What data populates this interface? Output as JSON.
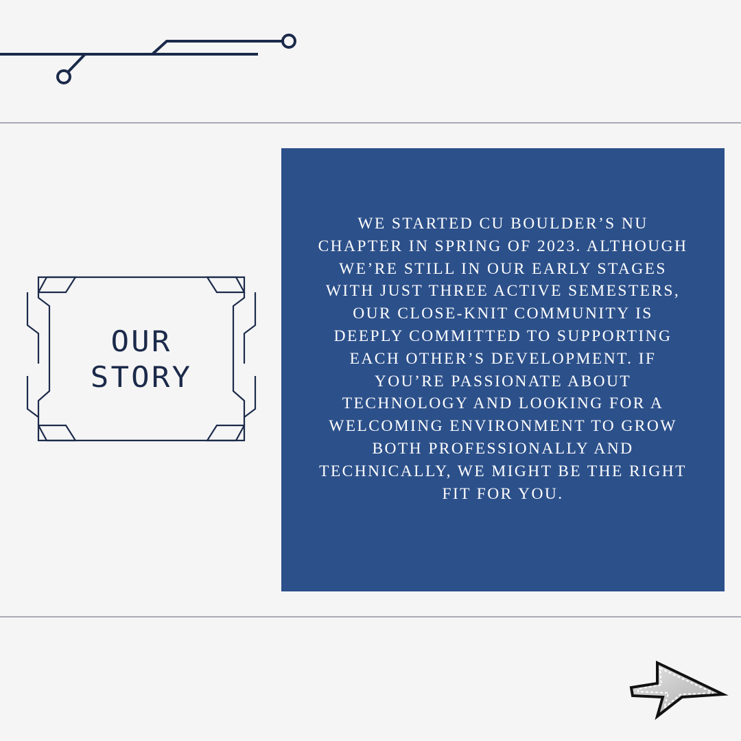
{
  "title": {
    "line1": "OUR",
    "line2": "STORY"
  },
  "story": {
    "paragraph": "We started CU Boulder’s NU chapter in Spring of 2023. Although we’re still in our early stages with just three active semesters, our close-knit community is deeply committed to supporting each other’s development. If you’re passionate about technology and looking for a welcoming environment to grow both professionally and technically, we might be the right fit for you."
  },
  "colors": {
    "background": "#f5f5f5",
    "panel": "#2c508a",
    "navy": "#1b2a4a",
    "divider": "#a9aab3"
  },
  "icons": {
    "circuit": "circuit-trace-icon",
    "frame": "tech-frame-icon",
    "cursor": "pixel-cursor-icon"
  }
}
